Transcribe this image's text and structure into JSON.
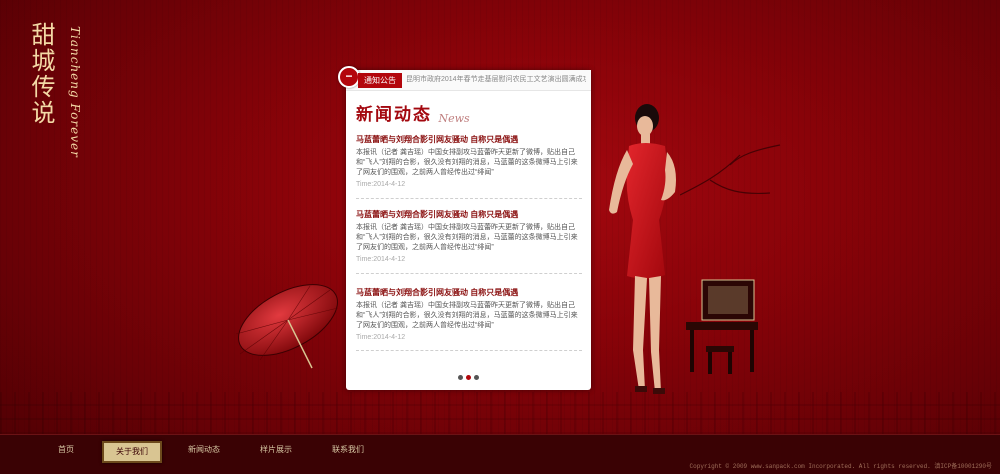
{
  "brand": {
    "logo_cn": "甜城传说",
    "logo_en": "Tiancheng Forever"
  },
  "notice": {
    "label": "通知公告",
    "icon": "minus-icon",
    "text": "昆明市政府2014年春节走基层慰问农民工文艺演出圆满成功"
  },
  "news": {
    "heading_cn": "新闻动态",
    "heading_en": "News",
    "items": [
      {
        "title": "马蓝蕾晒与刘翔合影引网友骚动 自称只是偶遇",
        "body": "本报讯（记者 龚吉瑶）中国女排副攻马蓝蕾昨天更新了微博，贴出自己和“飞人”刘翔的合影，很久没有刘翔的消息，马蓝蕾的这条微博马上引来了网友们的围观，之前两人曾经传出过“绯闻”",
        "time": "Time:2014-4-12"
      },
      {
        "title": "马蓝蕾晒与刘翔合影引网友骚动 自称只是偶遇",
        "body": "本报讯（记者 龚吉瑶）中国女排副攻马蓝蕾昨天更新了微博，贴出自己和“飞人”刘翔的合影，很久没有刘翔的消息，马蓝蕾的这条微博马上引来了网友们的围观，之前两人曾经传出过“绯闻”",
        "time": "Time:2014-4-12"
      },
      {
        "title": "马蓝蕾晒与刘翔合影引网友骚动 自称只是偶遇",
        "body": "本报讯（记者 龚吉瑶）中国女排副攻马蓝蕾昨天更新了微博，贴出自己和“飞人”刘翔的合影，很久没有刘翔的消息，马蓝蕾的这条微博马上引来了网友们的围观，之前两人曾经传出过“绯闻”",
        "time": "Time:2014-4-12"
      }
    ],
    "pager": {
      "total": 3,
      "active": 2
    }
  },
  "nav": {
    "items": [
      {
        "label": "首页"
      },
      {
        "label": "关于我们",
        "active": true
      },
      {
        "label": "新闻动态"
      },
      {
        "label": "样片展示"
      },
      {
        "label": "联系我们"
      }
    ]
  },
  "footer": {
    "copyright": "Copyright © 2009 www.sanpack.com Incorporated. All rights reserved. 滇ICP备10001290号"
  },
  "colors": {
    "background": "#8a0309",
    "accent": "#b3060c",
    "gold": "#d9c592",
    "footer": "#3a0204"
  }
}
